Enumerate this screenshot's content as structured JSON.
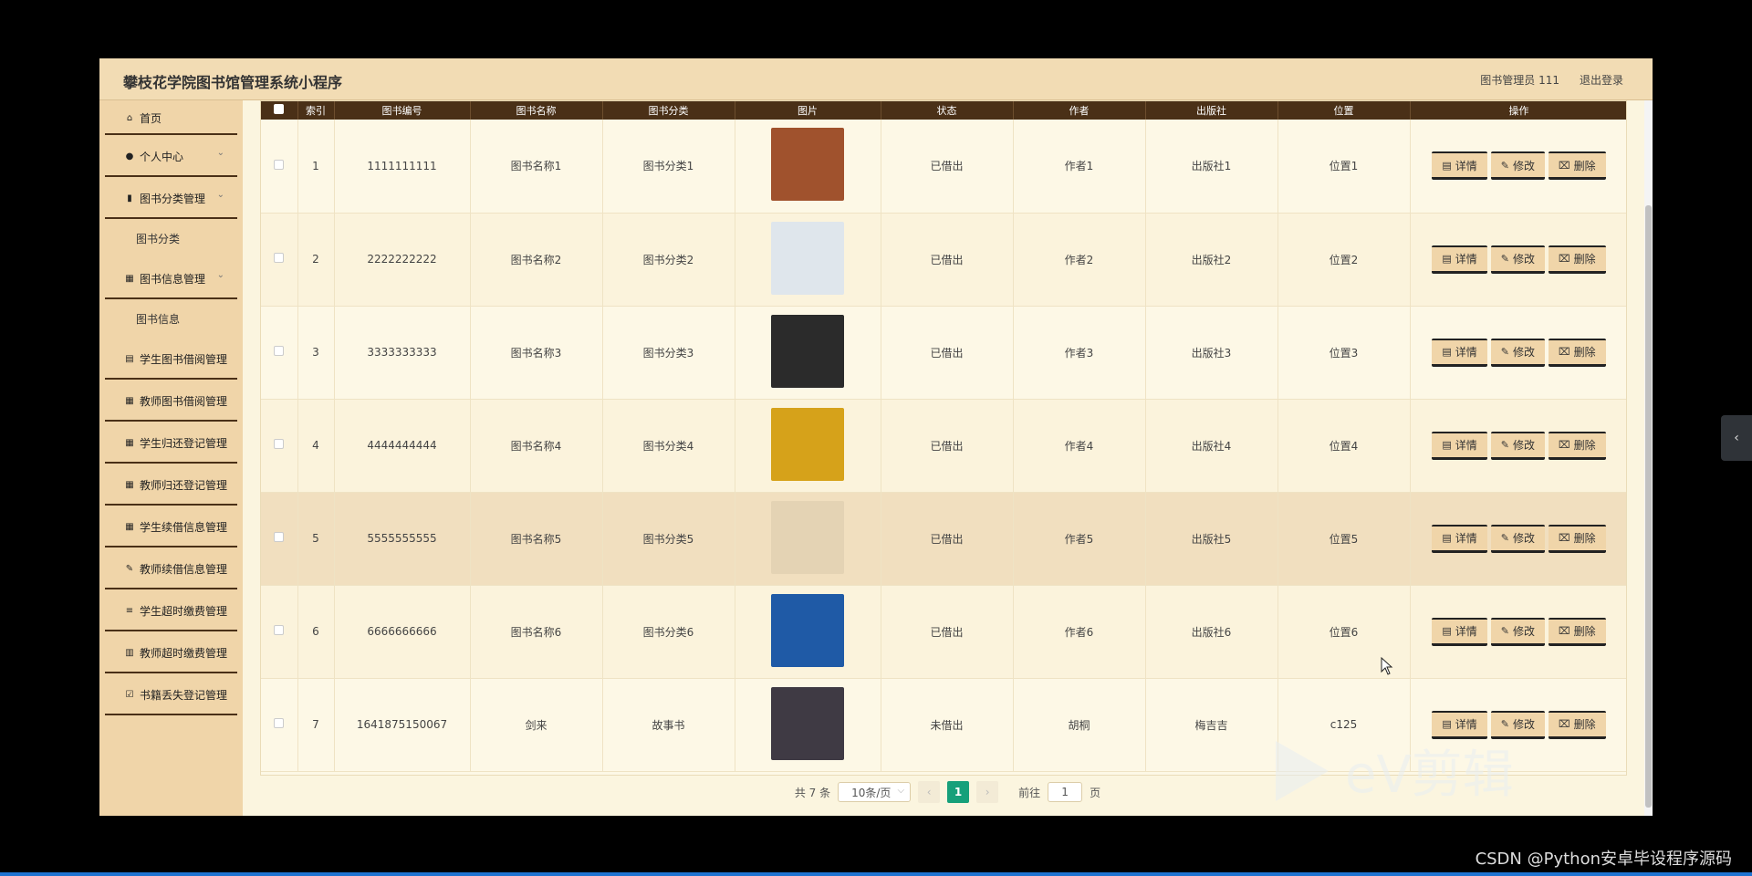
{
  "app": {
    "title": "攀枝花学院图书馆管理系统小程序",
    "user_label": "图书管理员 111",
    "logout_label": "退出登录"
  },
  "sidebar": {
    "items": [
      {
        "label": "首页",
        "icon": "home-icon",
        "type": "item"
      },
      {
        "label": "个人中心",
        "icon": "user-icon",
        "type": "item",
        "expandable": true
      },
      {
        "label": "图书分类管理",
        "icon": "bar-chart-icon",
        "type": "item",
        "expandable": true
      },
      {
        "label": "图书分类",
        "type": "sub"
      },
      {
        "label": "图书信息管理",
        "icon": "grid-icon",
        "type": "item",
        "expandable": true
      },
      {
        "label": "图书信息",
        "type": "sub"
      },
      {
        "label": "学生图书借阅管理",
        "icon": "briefcase-icon",
        "type": "item"
      },
      {
        "label": "教师图书借阅管理",
        "icon": "grid-icon",
        "type": "item"
      },
      {
        "label": "学生归还登记管理",
        "icon": "grid-icon",
        "type": "item"
      },
      {
        "label": "教师归还登记管理",
        "icon": "grid-icon",
        "type": "item"
      },
      {
        "label": "学生续借信息管理",
        "icon": "grid-icon",
        "type": "item"
      },
      {
        "label": "教师续借信息管理",
        "icon": "edit-icon",
        "type": "item"
      },
      {
        "label": "学生超时缴费管理",
        "icon": "list-icon",
        "type": "item"
      },
      {
        "label": "教师超时缴费管理",
        "icon": "library-icon",
        "type": "item"
      },
      {
        "label": "书籍丢失登记管理",
        "icon": "checkbox-icon",
        "type": "item"
      }
    ]
  },
  "table": {
    "columns": [
      "索引",
      "图书编号",
      "图书名称",
      "图书分类",
      "图片",
      "状态",
      "作者",
      "出版社",
      "位置",
      "操作"
    ],
    "rows": [
      {
        "index": "1",
        "code": "1111111111",
        "name": "图书名称1",
        "category": "图书分类1",
        "status": "已借出",
        "author": "作者1",
        "publisher": "出版社1",
        "location": "位置1",
        "cover_color": "#a0522d"
      },
      {
        "index": "2",
        "code": "2222222222",
        "name": "图书名称2",
        "category": "图书分类2",
        "status": "已借出",
        "author": "作者2",
        "publisher": "出版社2",
        "location": "位置2",
        "cover_color": "#dfe6ec"
      },
      {
        "index": "3",
        "code": "3333333333",
        "name": "图书名称3",
        "category": "图书分类3",
        "status": "已借出",
        "author": "作者3",
        "publisher": "出版社3",
        "location": "位置3",
        "cover_color": "#2b2b2b"
      },
      {
        "index": "4",
        "code": "4444444444",
        "name": "图书名称4",
        "category": "图书分类4",
        "status": "已借出",
        "author": "作者4",
        "publisher": "出版社4",
        "location": "位置4",
        "cover_color": "#d6a21a"
      },
      {
        "index": "5",
        "code": "5555555555",
        "name": "图书名称5",
        "category": "图书分类5",
        "status": "已借出",
        "author": "作者5",
        "publisher": "出版社5",
        "location": "位置5",
        "cover_color": "#e4d3b4"
      },
      {
        "index": "6",
        "code": "6666666666",
        "name": "图书名称6",
        "category": "图书分类6",
        "status": "已借出",
        "author": "作者6",
        "publisher": "出版社6",
        "location": "位置6",
        "cover_color": "#1f5aa6"
      },
      {
        "index": "7",
        "code": "1641875150067",
        "name": "剑来",
        "category": "故事书",
        "status": "未借出",
        "author": "胡桐",
        "publisher": "梅吉吉",
        "location": "c125",
        "cover_color": "#3f3a44"
      }
    ],
    "actions": {
      "detail": "详情",
      "edit": "修改",
      "delete": "删除"
    },
    "highlight_row": 5
  },
  "pagination": {
    "total": "共 7 条",
    "page_size": "10条/页",
    "current_page": "1",
    "goto_prefix": "前往",
    "goto_value": "1",
    "goto_suffix": "页"
  },
  "watermarks": {
    "ev": "eV剪辑",
    "csdn": "CSDN @Python安卓毕设程序源码"
  },
  "colors": {
    "topbar": "#f2dcb4",
    "sidebar": "#f0d5a9",
    "table_header": "#4a3017",
    "page_active": "#16a07a"
  }
}
